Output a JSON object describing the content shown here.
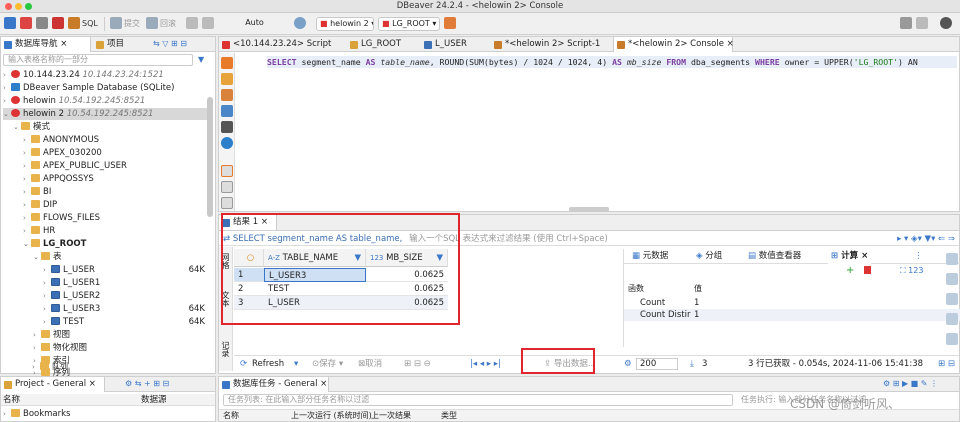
{
  "window": {
    "title": "DBeaver 24.2.4 - <helowin 2> Console"
  },
  "toolbar": {
    "sql_label": "SQL",
    "commit_label": "提交",
    "rollback_label": "回滚",
    "auto_label": "Auto",
    "connection_combo": "helowin 2",
    "schema_combo": "LG_ROOT"
  },
  "navigator": {
    "tab_label": "数据库导航",
    "project_tab_label": "项目",
    "filter_placeholder": "输入表格名称的一部分",
    "connections": [
      {
        "name": "10.144.23.24",
        "host": "10.144.23.24:1521"
      },
      {
        "name": "DBeaver Sample Database (SQLite)",
        "host": ""
      },
      {
        "name": "helowin",
        "host": "10.54.192.245:8521"
      },
      {
        "name": "helowin 2",
        "host": "10.54.192.245:8521"
      }
    ],
    "schemas_label": "模式",
    "schemas": [
      "ANONYMOUS",
      "APEX_030200",
      "APEX_PUBLIC_USER",
      "APPQOSSYS",
      "BI",
      "DIP",
      "FLOWS_FILES",
      "HR",
      "LG_ROOT"
    ],
    "tables_label": "表",
    "tables": [
      {
        "name": "L_USER",
        "size": "64K"
      },
      {
        "name": "L_USER1",
        "size": ""
      },
      {
        "name": "L_USER2",
        "size": ""
      },
      {
        "name": "L_USER3",
        "size": "64K"
      },
      {
        "name": "TEST",
        "size": "64K"
      }
    ],
    "other_nodes": [
      "视图",
      "物化视图",
      "索引",
      "序列",
      "队列"
    ]
  },
  "editor_tabs": [
    "<10.144.23.24> Script",
    "LG_ROOT",
    "L_USER",
    "*<helowin 2> Script-1",
    "*<helowin 2> Console"
  ],
  "sql": {
    "kw_select": "SELECT",
    "p1": " segment_name ",
    "kw_as": "AS",
    "alias1": " table_name",
    "p2": ", ROUND(SUM(bytes) / 1024 / 1024, 4) ",
    "kw_as2": "AS",
    "alias2": " mb_size ",
    "kw_from": "FROM",
    "p3": " dba_segments  ",
    "kw_where": "WHERE",
    "p4": "  owner = UPPER(",
    "str": "'LG_ROOT'",
    "p5": ")  AN"
  },
  "results": {
    "tab_label": "结果 1",
    "query_preview": "SELECT segment_name AS table_name,",
    "filter_placeholder": "输入一个SQL 表达式来过滤结果 (使用 Ctrl+Space)",
    "columns": [
      "TABLE_NAME",
      "MB_SIZE"
    ],
    "col_type_1": "A-Z",
    "col_type_2": "123",
    "rows": [
      {
        "n": "1",
        "name": "L_USER3",
        "size": "0.0625"
      },
      {
        "n": "2",
        "name": "TEST",
        "size": "0.0625"
      },
      {
        "n": "3",
        "name": "L_USER",
        "size": "0.0625"
      }
    ],
    "side_tabs": {
      "grid": "网格",
      "text": "文本",
      "record": "记录"
    },
    "refresh_label": "Refresh",
    "save_label": "保存",
    "cancel_label": "取消",
    "export_label": "导出数据...",
    "fetch_size": "200",
    "row_count": "3",
    "status": "3 行已获取 - 0.054s, 2024-11-06 15:41:38"
  },
  "calc_panel": {
    "tabs": [
      "元数据",
      "分组",
      "数值查看器",
      "计算"
    ],
    "col_func": "函数",
    "col_value": "值",
    "rows": [
      {
        "func": "Count",
        "value": "1"
      },
      {
        "func": "Count Distir",
        "value": "1"
      }
    ]
  },
  "project_panel": {
    "tab_label": "Project - General",
    "col_name": "名称",
    "col_source": "数据源",
    "bookmarks": "Bookmarks"
  },
  "tasks_panel": {
    "tab_label": "数据库任务 - General",
    "filter_placeholder": "任务列表: 在此输入部分任务名称以过滤",
    "col_name": "名称",
    "col_last_run": "上一次运行 (系统时间)",
    "col_last_result": "上一次结果",
    "col_type": "类型",
    "exec_placeholder": "任务执行: 输入部分任务名称以过滤"
  },
  "watermark": "CSDN @倚剑听风、",
  "colors": {
    "highlight_box": "#e0252f",
    "keyword": "#7b3fa2",
    "selection": "#cfe0f5"
  }
}
